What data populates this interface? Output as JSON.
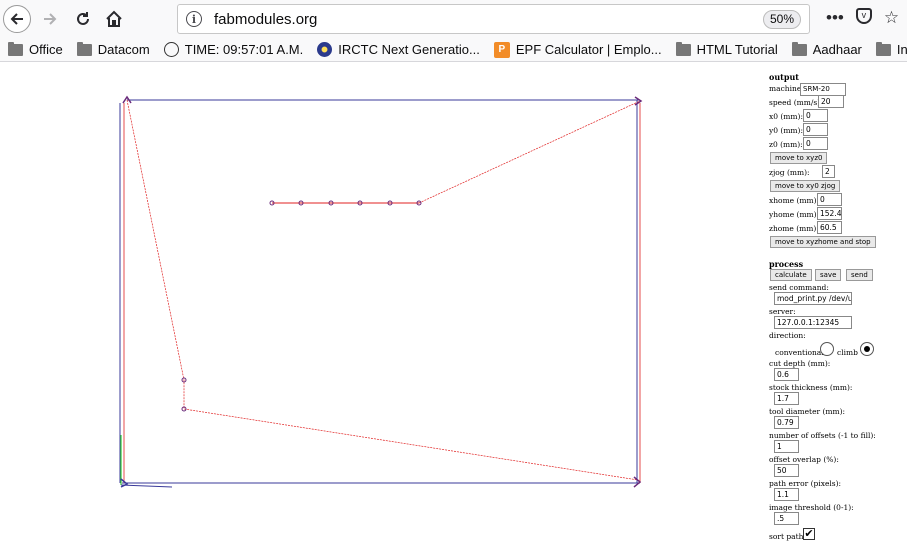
{
  "browser": {
    "url": "fabmodules.org",
    "zoom": "50%",
    "bookmarks": [
      {
        "label": "Office",
        "icon": "folder-icon"
      },
      {
        "label": "Datacom",
        "icon": "folder-icon"
      },
      {
        "label": "TIME: 09:57:01 A.M.",
        "icon": "globe-icon"
      },
      {
        "label": "IRCTC Next Generatio...",
        "icon": "irctc-icon"
      },
      {
        "label": "EPF Calculator | Emplo...",
        "icon": "epf-icon"
      },
      {
        "label": "HTML Tutorial",
        "icon": "folder-icon"
      },
      {
        "label": "Aadhaar",
        "icon": "folder-icon"
      },
      {
        "label": "Income Tax",
        "icon": "folder-icon"
      }
    ]
  },
  "output": {
    "heading": "output",
    "machine_label": "machine",
    "machine_value": "SRM-20",
    "speed_label": "speed (mm/s):",
    "speed_value": "20",
    "x0_label": "x0 (mm):",
    "x0_value": "0",
    "y0_label": "y0 (mm):",
    "y0_value": "0",
    "z0_label": "z0 (mm):",
    "z0_value": "0",
    "move_xyz0_button": "move to xyz0",
    "zjog_label": "zjog (mm):",
    "zjog_value": "2",
    "move_xy0_zjog_button": "move to xy0 zjog",
    "xhome_label": "xhome (mm):",
    "xhome_value": "0",
    "yhome_label": "yhome (mm):",
    "yhome_value": "152.4",
    "zhome_label": "zhome (mm):",
    "zhome_value": "60.5",
    "move_home_button": "move to xyzhome and stop"
  },
  "process": {
    "heading": "process",
    "calculate_button": "calculate",
    "save_button": "save",
    "send_button": "send",
    "send_command_label": "send command:",
    "send_command_value": "mod_print.py /dev/usb",
    "server_label": "server:",
    "server_value": "127.0.0.1:12345",
    "direction_label": "direction:",
    "conventional_label": "conventional",
    "climb_label": "climb",
    "direction_selected": "climb",
    "cut_depth_label": "cut depth (mm):",
    "cut_depth_value": "0.6",
    "stock_thickness_label": "stock thickness (mm):",
    "stock_thickness_value": "1.7",
    "tool_diameter_label": "tool diameter (mm):",
    "tool_diameter_value": "0.79",
    "offsets_label": "number of offsets (-1 to fill):",
    "offsets_value": "1",
    "overlap_label": "offset overlap (%):",
    "overlap_value": "50",
    "path_error_label": "path error (pixels):",
    "path_error_value": "1.1",
    "threshold_label": "image threshold (0-1):",
    "threshold_value": ".5",
    "sort_path_label": "sort path:",
    "sort_path_checked": true
  },
  "colors": {
    "path_red": "#e02020",
    "outline_blue": "#3a3a9a",
    "axis_green": "#33cc33",
    "node_purple": "#6a2a7a"
  }
}
